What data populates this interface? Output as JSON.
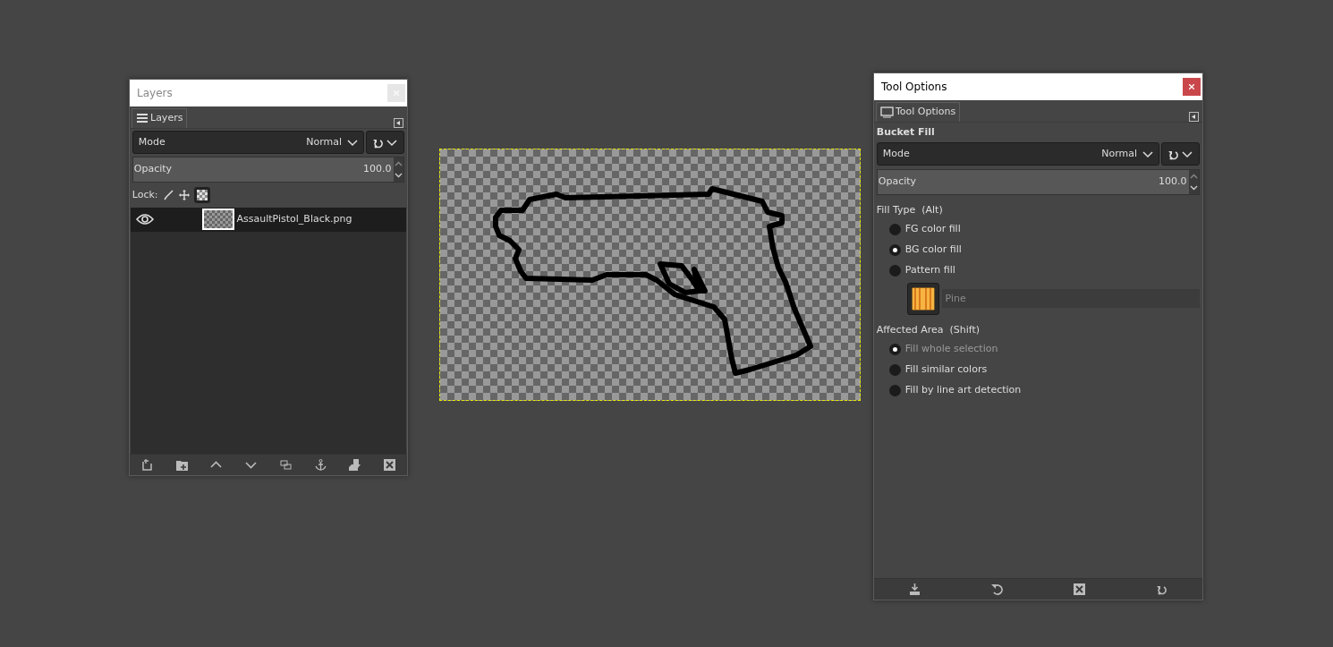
{
  "layers_window": {
    "title": "Layers",
    "tab": {
      "label": "Layers"
    },
    "mode": {
      "label": "Mode",
      "value": "Normal"
    },
    "opacity": {
      "label": "Opacity",
      "value": "100.0"
    },
    "lock": {
      "label": "Lock:",
      "alpha_locked": true
    },
    "layers": [
      {
        "name": "AssaultPistol_Black.png",
        "visible": true,
        "selected": true
      }
    ]
  },
  "tool_options_window": {
    "title": "Tool Options",
    "tab": {
      "label": "Tool Options"
    },
    "tool_name": "Bucket Fill",
    "mode": {
      "label": "Mode",
      "value": "Normal"
    },
    "opacity": {
      "label": "Opacity",
      "value": "100.0"
    },
    "fill_type": {
      "label": "Fill Type  (Alt)",
      "options": [
        {
          "label": "FG color fill",
          "selected": false,
          "disabled": false
        },
        {
          "label": "BG color fill",
          "selected": true,
          "disabled": false
        },
        {
          "label": "Pattern fill",
          "selected": false,
          "disabled": false
        }
      ]
    },
    "pattern": {
      "name": "Pine",
      "disabled": true
    },
    "affected_area": {
      "label": "Affected Area  (Shift)",
      "options": [
        {
          "label": "Fill whole selection",
          "selected": true,
          "disabled": true
        },
        {
          "label": "Fill similar colors",
          "selected": false,
          "disabled": false
        },
        {
          "label": "Fill by line art detection",
          "selected": false,
          "disabled": false
        }
      ]
    }
  }
}
